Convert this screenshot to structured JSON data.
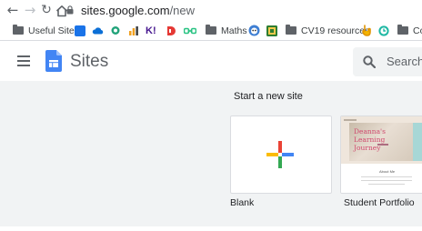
{
  "browser": {
    "url_domain": "sites.google.com",
    "url_path": "/new",
    "bookmarks": [
      {
        "label": "Useful Sites",
        "icon": "folder-icon"
      },
      {
        "label": "",
        "icon": "account-icon",
        "color": "#1a73e8"
      },
      {
        "label": "",
        "icon": "cloud-icon",
        "color": "#0b6fd6"
      },
      {
        "label": "",
        "icon": "chat-icon",
        "color": "#22a37a"
      },
      {
        "label": "",
        "icon": "bars-icon",
        "color": "#f0a020"
      },
      {
        "label": "K!",
        "icon": "kahoot-icon",
        "color": "#46178f"
      },
      {
        "label": "",
        "icon": "d-icon",
        "color": "#e53935"
      },
      {
        "label": "",
        "icon": "link-icon",
        "color": "#26c281"
      },
      {
        "label": "Maths",
        "icon": "folder-icon"
      },
      {
        "label": "",
        "icon": "mascot-icon",
        "color": "#3f7fd3"
      },
      {
        "label": "",
        "icon": "grid-icon",
        "color": "#f2c94c"
      },
      {
        "label": "CV19 resources",
        "icon": "folder-icon"
      },
      {
        "label": "",
        "icon": "hand-icon",
        "color": "#f4b400"
      },
      {
        "label": "",
        "icon": "ring-icon",
        "color": "#1fb8a4"
      },
      {
        "label": "Co",
        "icon": "folder-icon"
      }
    ]
  },
  "header": {
    "app_title": "Sites",
    "search_placeholder": "Search"
  },
  "gallery": {
    "section_title": "Start a new site",
    "templates": [
      {
        "label": "Blank"
      },
      {
        "label": "Student Portfolio",
        "thumb_title": "Deanna's Learning Journey",
        "thumb_section": "About Me"
      }
    ]
  }
}
